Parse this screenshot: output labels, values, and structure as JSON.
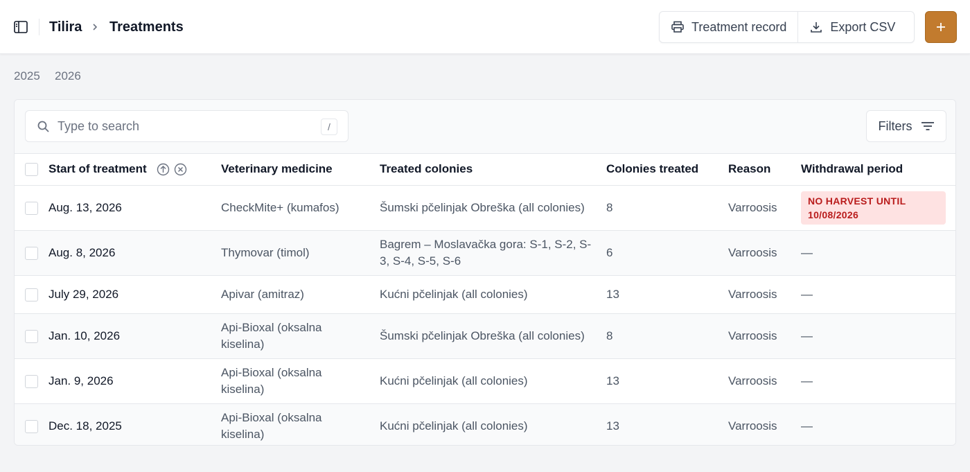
{
  "breadcrumb": {
    "root": "Tilira",
    "current": "Treatments"
  },
  "actions": {
    "treatment_record": "Treatment record",
    "export_csv": "Export CSV",
    "add_icon": "plus-icon"
  },
  "years": [
    "2025",
    "2026"
  ],
  "search": {
    "placeholder": "Type to search",
    "shortcut": "/"
  },
  "filters_label": "Filters",
  "columns": {
    "start": "Start of treatment",
    "medicine": "Veterinary medicine",
    "colonies": "Treated colonies",
    "count": "Colonies treated",
    "reason": "Reason",
    "withdrawal": "Withdrawal period"
  },
  "rows": [
    {
      "date": "Aug. 13, 2026",
      "medicine": "CheckMite+ (kumafos)",
      "colonies": "Šumski pčelinjak Obreška (all colonies)",
      "count": "8",
      "reason": "Varroosis",
      "withdrawal": "NO HARVEST UNTIL 10/08/2026",
      "withdrawal_alert": true
    },
    {
      "date": "Aug. 8, 2026",
      "medicine": "Thymovar (timol)",
      "colonies": "Bagrem – Moslavačka gora: S-1, S-2, S-3, S-4, S-5, S-6",
      "count": "6",
      "reason": "Varroosis",
      "withdrawal": "—",
      "withdrawal_alert": false
    },
    {
      "date": "July 29, 2026",
      "medicine": "Apivar (amitraz)",
      "colonies": "Kućni pčelinjak (all colonies)",
      "count": "13",
      "reason": "Varroosis",
      "withdrawal": "—",
      "withdrawal_alert": false
    },
    {
      "date": "Jan. 10, 2026",
      "medicine": "Api-Bioxal (oksalna kiselina)",
      "colonies": "Šumski pčelinjak Obreška (all colonies)",
      "count": "8",
      "reason": "Varroosis",
      "withdrawal": "—",
      "withdrawal_alert": false
    },
    {
      "date": "Jan. 9, 2026",
      "medicine": "Api-Bioxal (oksalna kiselina)",
      "colonies": "Kućni pčelinjak (all colonies)",
      "count": "13",
      "reason": "Varroosis",
      "withdrawal": "—",
      "withdrawal_alert": false
    },
    {
      "date": "Dec. 18, 2025",
      "medicine": "Api-Bioxal (oksalna kiselina)",
      "colonies": "Kućni pčelinjak (all colonies)",
      "count": "13",
      "reason": "Varroosis",
      "withdrawal": "—",
      "withdrawal_alert": false
    }
  ],
  "colors": {
    "accent": "#c27b2e",
    "alert_bg": "#fee2e2",
    "alert_text": "#b91c1c"
  }
}
